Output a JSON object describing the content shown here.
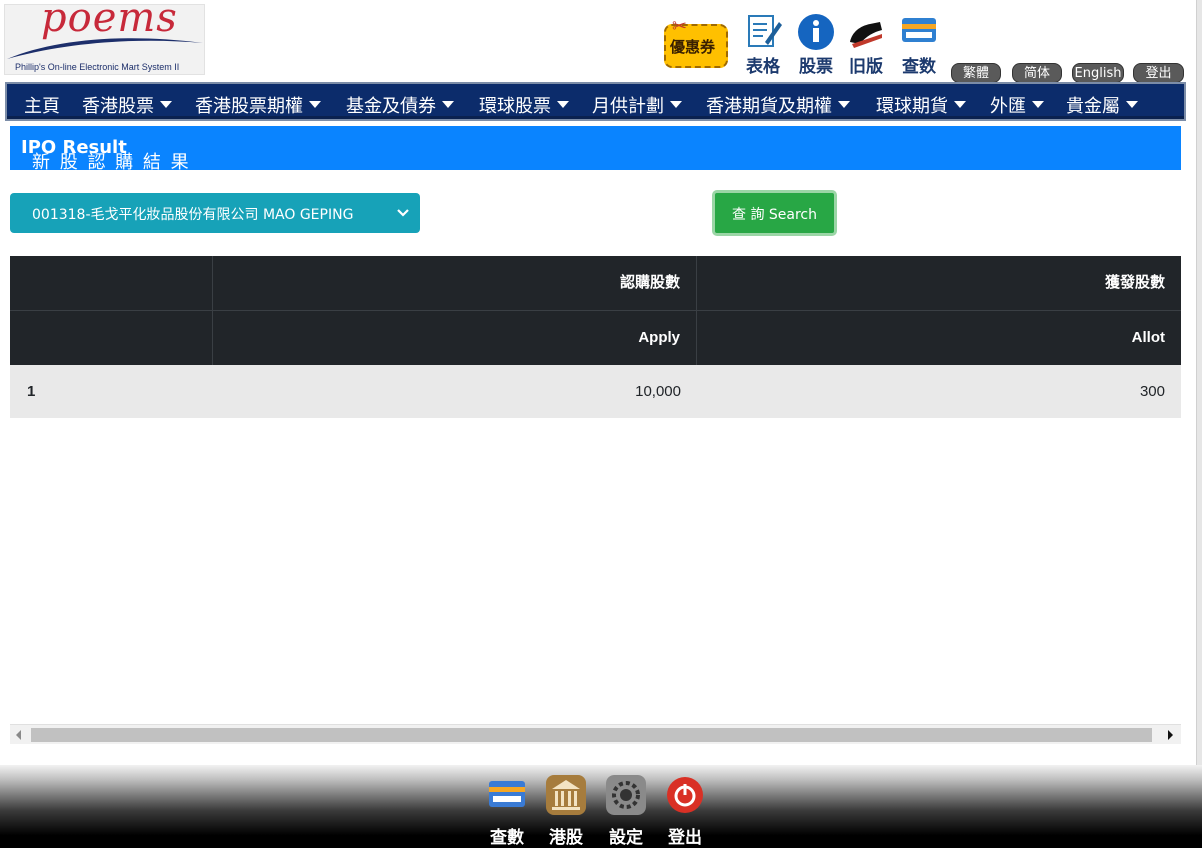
{
  "header": {
    "logo_word": "poems",
    "logo_tagline": "Phillip's On-line Electronic Mart System II",
    "coupon_label": "優惠券",
    "top_icons": [
      {
        "name": "form-icon",
        "label": "表格"
      },
      {
        "name": "info-icon",
        "label": "股票"
      },
      {
        "name": "legacy-icon",
        "label": "旧版"
      },
      {
        "name": "account-icon",
        "label": "查数"
      }
    ],
    "lang_buttons": [
      "繁體",
      "简体",
      "English",
      "登出"
    ]
  },
  "nav": {
    "items": [
      {
        "label": "主頁",
        "dropdown": false
      },
      {
        "label": "香港股票",
        "dropdown": true
      },
      {
        "label": "香港股票期權",
        "dropdown": true
      },
      {
        "label": "基金及債券",
        "dropdown": true
      },
      {
        "label": "環球股票",
        "dropdown": true
      },
      {
        "label": "月供計劃",
        "dropdown": true
      },
      {
        "label": "香港期貨及期權",
        "dropdown": true
      },
      {
        "label": "環球期貨",
        "dropdown": true
      },
      {
        "label": "外匯",
        "dropdown": true
      },
      {
        "label": "貴金屬",
        "dropdown": true
      }
    ]
  },
  "page": {
    "title_zh": "新 股 認 購 結 果",
    "title_en": "IPO Result"
  },
  "form": {
    "stock_select_value": "001318-毛戈平化妝品股份有限公司 MAO GEPING",
    "search_label": "查 詢 Search"
  },
  "table": {
    "headers_zh": [
      "",
      "認購股數",
      "獲發股數"
    ],
    "headers_en": [
      "",
      "Apply",
      "Allot"
    ],
    "rows": [
      [
        "1",
        "10,000",
        "300"
      ]
    ]
  },
  "bottom_bar": {
    "items": [
      {
        "name": "account-query-icon",
        "label": "查數",
        "color": "#3a7bd5"
      },
      {
        "name": "hk-stock-icon",
        "label": "港股",
        "color": "#a67c3d"
      },
      {
        "name": "settings-icon",
        "label": "設定",
        "color": "#7a7a7a"
      },
      {
        "name": "logout-icon",
        "label": "登出",
        "color": "#d93025"
      }
    ]
  },
  "colors": {
    "nav_bg": "#0c2c6b",
    "title_bar": "#0a84ff",
    "select_bg": "#17a2b8",
    "search_btn": "#28a745",
    "table_head": "#212529"
  }
}
